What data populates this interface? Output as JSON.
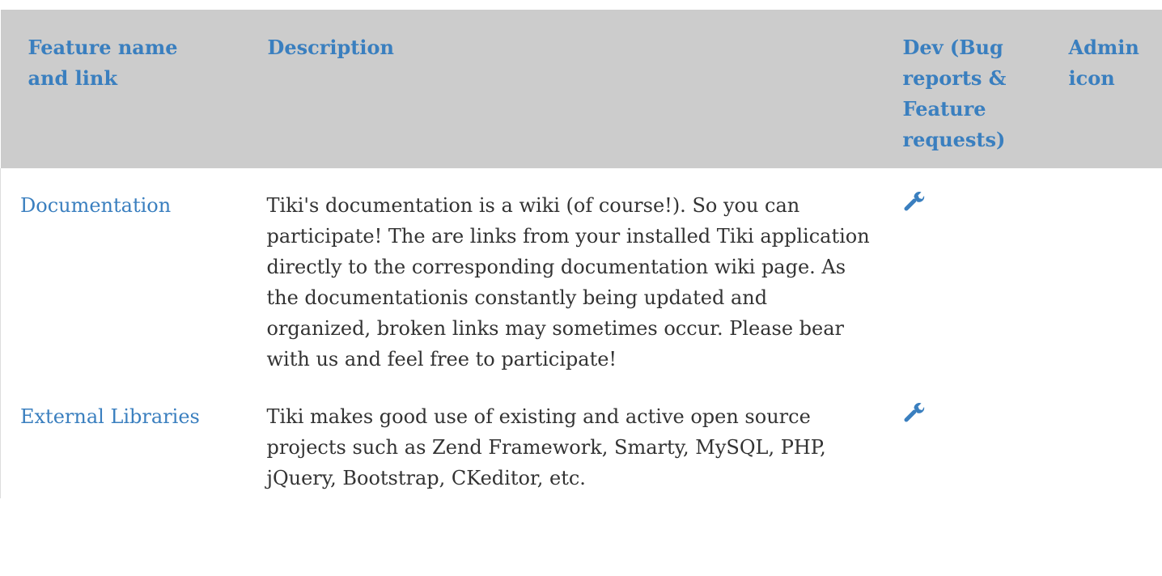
{
  "table": {
    "headers": {
      "feature_name": "Feature name and link",
      "description": "Description",
      "dev": "Dev (Bug reports & Feature requests)",
      "admin": "Admin icon"
    },
    "rows": [
      {
        "name": "Documentation",
        "description": "Tiki's documentation is a wiki (of course!). So you can participate! The are links from your installed Tiki application directly to the corresponding documentation wiki page. As the documentationis constantly being updated and organized, broken links may sometimes occur. Please bear with us and feel free to participate!",
        "dev_icon": "wrench-icon",
        "admin": ""
      },
      {
        "name": "External Libraries",
        "description": "Tiki makes good use of existing and active open source projects such as Zend Framework, Smarty, MySQL, PHP, jQuery, Bootstrap, CKeditor, etc.",
        "dev_icon": "wrench-icon",
        "admin": ""
      }
    ]
  },
  "colors": {
    "header_background": "#cccccc",
    "link": "#3a7fbf",
    "text": "#333333"
  }
}
